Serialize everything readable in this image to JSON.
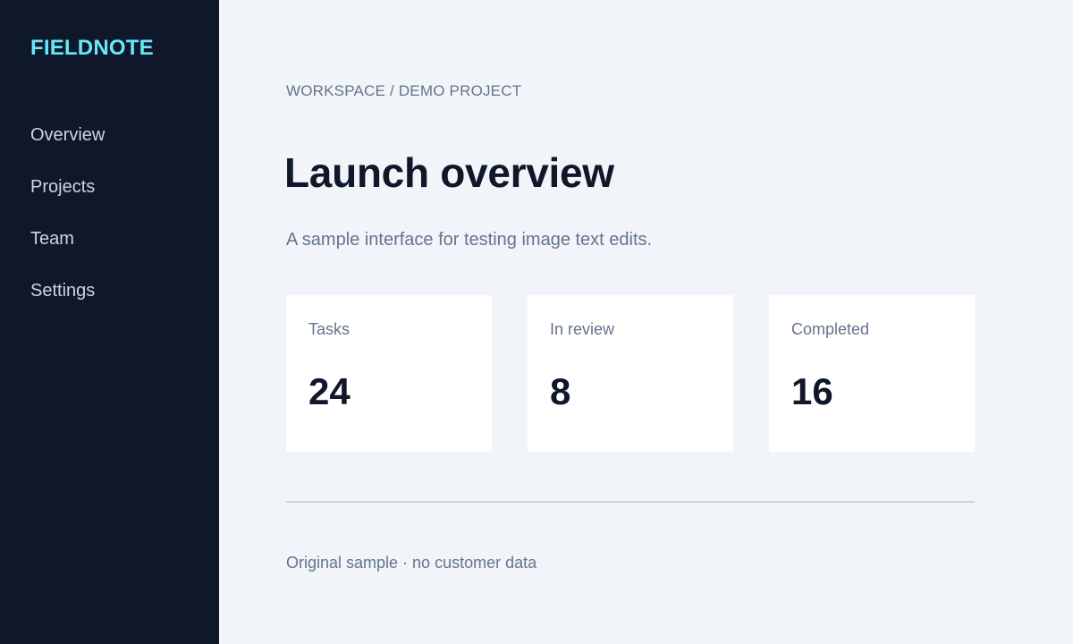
{
  "sidebar": {
    "brand": "FIELDNOTE",
    "items": [
      {
        "label": "Overview"
      },
      {
        "label": "Projects"
      },
      {
        "label": "Team"
      },
      {
        "label": "Settings"
      }
    ]
  },
  "main": {
    "breadcrumb": "WORKSPACE / DEMO PROJECT",
    "title": "Launch overview",
    "subtitle": "A sample interface for testing image text edits.",
    "cards": [
      {
        "label": "Tasks",
        "value": "24"
      },
      {
        "label": "In review",
        "value": "8"
      },
      {
        "label": "Completed",
        "value": "16"
      }
    ],
    "footer": "Original sample · no customer data"
  },
  "colors": {
    "sidebar_bg": "#0f172a",
    "brand": "#67e8f9",
    "page_bg": "#f1f5f9",
    "card_bg": "#ffffff",
    "title": "#0f172a",
    "muted": "#64748b"
  }
}
